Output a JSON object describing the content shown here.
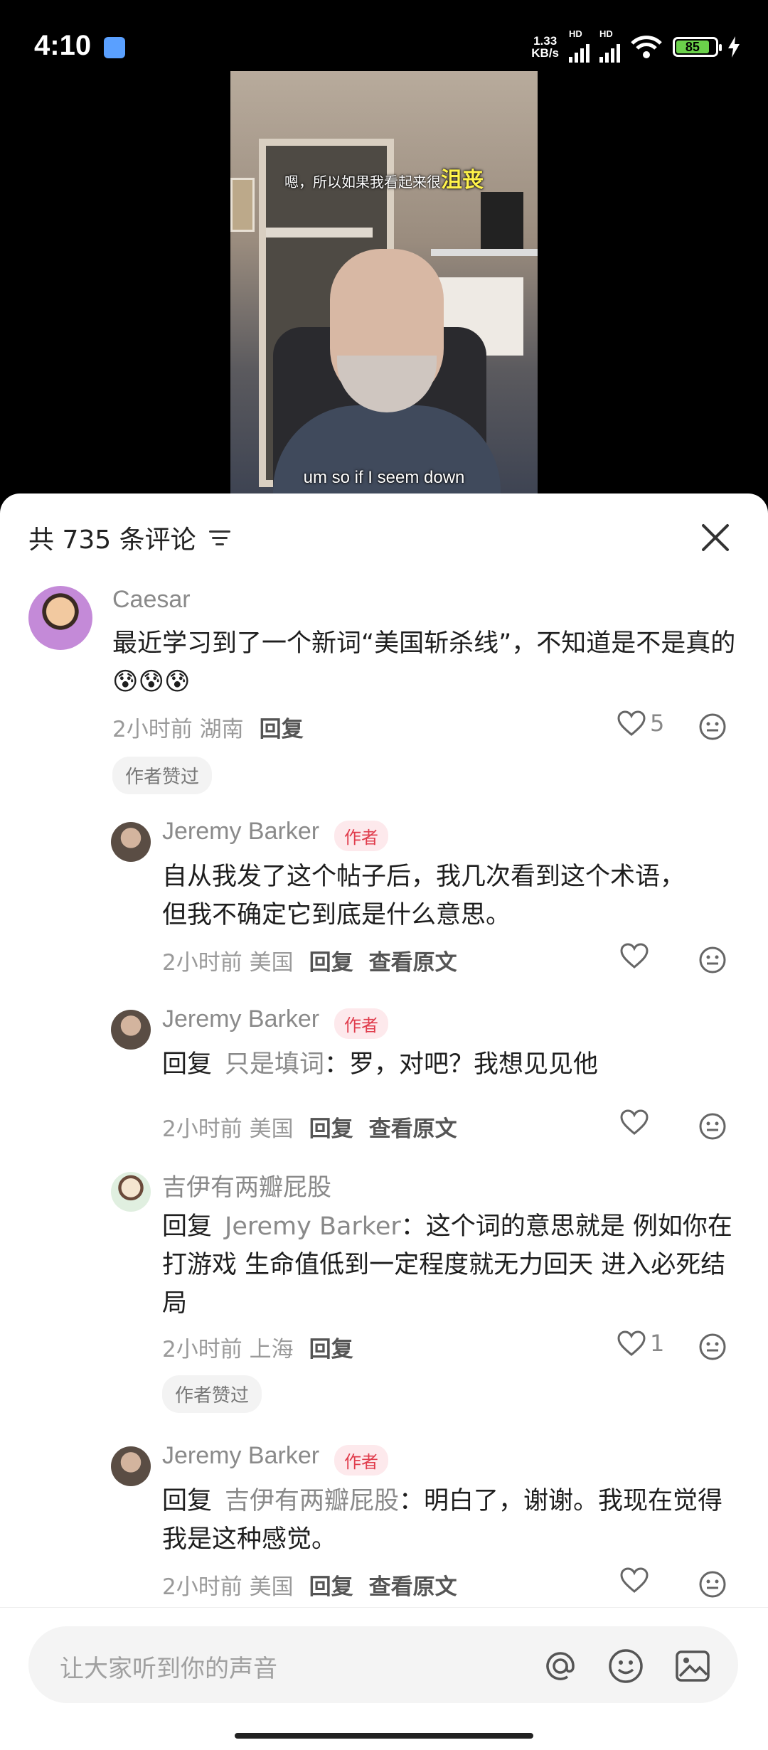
{
  "status_bar": {
    "time": "4:10",
    "speed_top": "1.33",
    "speed_bottom": "KB/s",
    "hd1": "HD",
    "hd2": "HD",
    "battery": "85"
  },
  "video": {
    "subtitle_cn_prefix": "嗯，所以如果我看起来很",
    "subtitle_cn_highlight": "沮丧",
    "subtitle_en": "um so if I seem down"
  },
  "comments_header": {
    "count_label": "共 735 条评论"
  },
  "comments": [
    {
      "user": "Caesar",
      "text": "最近学习到了一个新词“美国斩杀线”，不知道是不是真的😰😰😰",
      "time": "2小时前",
      "location": "湖南",
      "reply_label": "回复",
      "likes": "5",
      "author_liked": "作者赞过"
    },
    {
      "user": "Jeremy Barker",
      "author_tag": "作者",
      "text": "自从我发了这个帖子后，我几次看到这个术语，但我不确定它到底是什么意思。",
      "time": "2小时前",
      "location": "美国",
      "reply_label": "回复",
      "view_original": "查看原文"
    },
    {
      "user": "Jeremy Barker",
      "author_tag": "作者",
      "reply_prefix": "回复",
      "reply_to": "只是填词",
      "text": "：罗，对吧？我想见见他",
      "time": "2小时前",
      "location": "美国",
      "reply_label": "回复",
      "view_original": "查看原文"
    },
    {
      "user": "吉伊有两瓣屁股",
      "reply_prefix": "回复",
      "reply_to": "Jeremy Barker",
      "text": "：这个词的意思就是 例如你在打游戏 生命值低到一定程度就无力回天 进入必死结局",
      "time": "2小时前",
      "location": "上海",
      "reply_label": "回复",
      "likes": "1",
      "author_liked": "作者赞过"
    },
    {
      "user": "Jeremy Barker",
      "author_tag": "作者",
      "reply_prefix": "回复",
      "reply_to": "吉伊有两瓣屁股",
      "text": "：明白了，谢谢。我现在觉得我是这种感觉。",
      "time": "2小时前",
      "location": "美国",
      "reply_label": "回复",
      "view_original": "查看原文"
    }
  ],
  "input": {
    "placeholder": "让大家听到你的声音"
  }
}
